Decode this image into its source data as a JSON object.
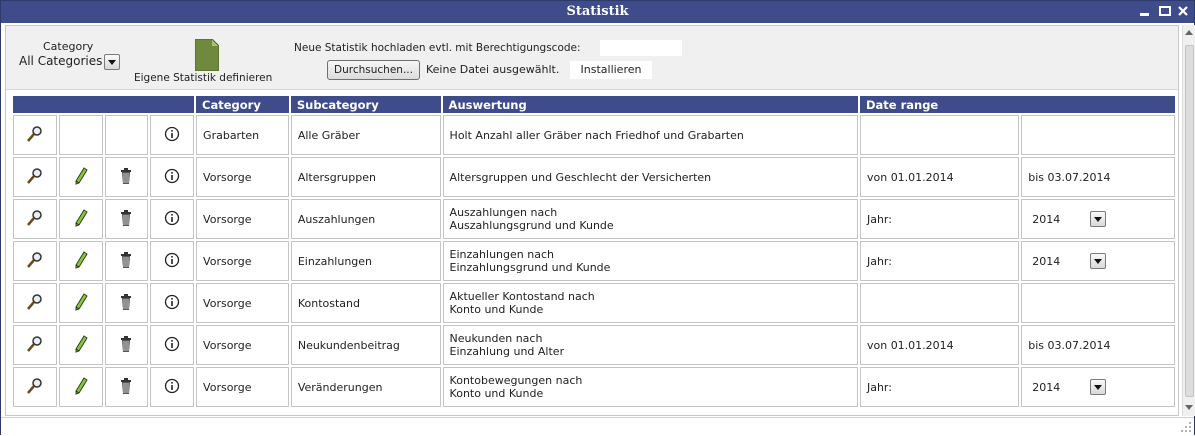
{
  "window": {
    "title": "Statistik",
    "minimize_icon": "minimize-icon",
    "restore_icon": "restore-icon",
    "close_icon": "close-icon"
  },
  "filter": {
    "category_label": "Category",
    "category_value": "All Categories"
  },
  "define": {
    "label": "Eigene Statistik definieren",
    "icon": "document-icon"
  },
  "upload": {
    "label": "Neue Statistik hochladen evtl. mit Berechtigungscode:",
    "code_value": "",
    "browse_label": "Durchsuchen...",
    "no_file": "Keine Datei ausgewählt.",
    "install_label": "Installieren"
  },
  "table": {
    "headers": [
      "",
      "Category",
      "Subcategory",
      "Auswertung",
      "Date range"
    ],
    "rows": [
      {
        "edit": false,
        "category": "Grabarten",
        "subcategory": "Alle Gräber",
        "auswertung1": "Holt Anzahl aller Gräber nach Friedhof und Grabarten",
        "auswertung2": "",
        "from_label": "",
        "from_value": "",
        "to_label": "",
        "to_value": "",
        "year": ""
      },
      {
        "edit": true,
        "category": "Vorsorge",
        "subcategory": "Altersgruppen",
        "auswertung1": "Altersgruppen und Geschlecht der Versicherten",
        "auswertung2": "",
        "from_label": "von",
        "from_value": "01.01.2014",
        "to_label": "bis",
        "to_value": "03.07.2014",
        "year": ""
      },
      {
        "edit": true,
        "category": "Vorsorge",
        "subcategory": "Auszahlungen",
        "auswertung1": "Auszahlungen nach",
        "auswertung2": "Auszahlungsgrund und Kunde",
        "from_label": "Jahr:",
        "from_value": "",
        "to_label": "",
        "to_value": "",
        "year": "2014"
      },
      {
        "edit": true,
        "category": "Vorsorge",
        "subcategory": "Einzahlungen",
        "auswertung1": "Einzahlungen nach",
        "auswertung2": "Einzahlungsgrund und Kunde",
        "from_label": "Jahr:",
        "from_value": "",
        "to_label": "",
        "to_value": "",
        "year": "2014"
      },
      {
        "edit": true,
        "category": "Vorsorge",
        "subcategory": "Kontostand",
        "auswertung1": "Aktueller Kontostand nach",
        "auswertung2": "Konto und Kunde",
        "from_label": "",
        "from_value": "",
        "to_label": "",
        "to_value": "",
        "year": ""
      },
      {
        "edit": true,
        "category": "Vorsorge",
        "subcategory": "Neukundenbeitrag",
        "auswertung1": "Neukunden nach",
        "auswertung2": "Einzahlung und Alter",
        "from_label": "von",
        "from_value": "01.01.2014",
        "to_label": "bis",
        "to_value": "03.07.2014",
        "year": ""
      },
      {
        "edit": true,
        "category": "Vorsorge",
        "subcategory": "Veränderungen",
        "auswertung1": "Kontobewegungen nach",
        "auswertung2": "Konto und Kunde",
        "from_label": "Jahr:",
        "from_value": "",
        "to_label": "",
        "to_value": "",
        "year": "2014"
      }
    ]
  }
}
